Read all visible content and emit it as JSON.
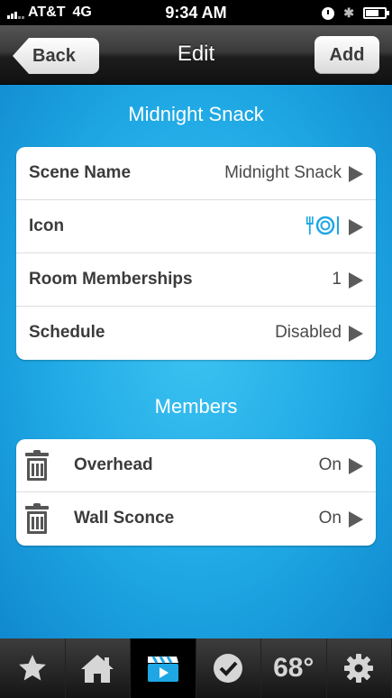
{
  "status_bar": {
    "carrier": "AT&T",
    "network": "4G",
    "time": "9:34 AM"
  },
  "nav": {
    "back_label": "Back",
    "title": "Edit",
    "add_label": "Add"
  },
  "scene": {
    "header": "Midnight Snack",
    "rows": [
      {
        "label": "Scene Name",
        "value": "Midnight Snack"
      },
      {
        "label": "Icon",
        "value": "",
        "icon": "dining-icon"
      },
      {
        "label": "Room Memberships",
        "value": "1"
      },
      {
        "label": "Schedule",
        "value": "Disabled"
      }
    ]
  },
  "members": {
    "header": "Members",
    "items": [
      {
        "label": "Overhead",
        "value": "On",
        "icon": "trash-icon"
      },
      {
        "label": "Wall Sconce",
        "value": "On",
        "icon": "trash-icon"
      }
    ]
  },
  "tabbar": {
    "tabs": [
      {
        "name": "favorites",
        "icon": "star-icon"
      },
      {
        "name": "rooms",
        "icon": "home-icon"
      },
      {
        "name": "scenes",
        "icon": "clapperboard-icon",
        "active": true
      },
      {
        "name": "tasks",
        "icon": "checkmark-icon"
      },
      {
        "name": "thermostat",
        "text": "68°"
      },
      {
        "name": "settings",
        "icon": "gear-icon"
      }
    ]
  },
  "colors": {
    "background_blue": "#1fa8e4",
    "accent_blue": "#1ea7e4",
    "navbar": "#2a2a2a"
  }
}
